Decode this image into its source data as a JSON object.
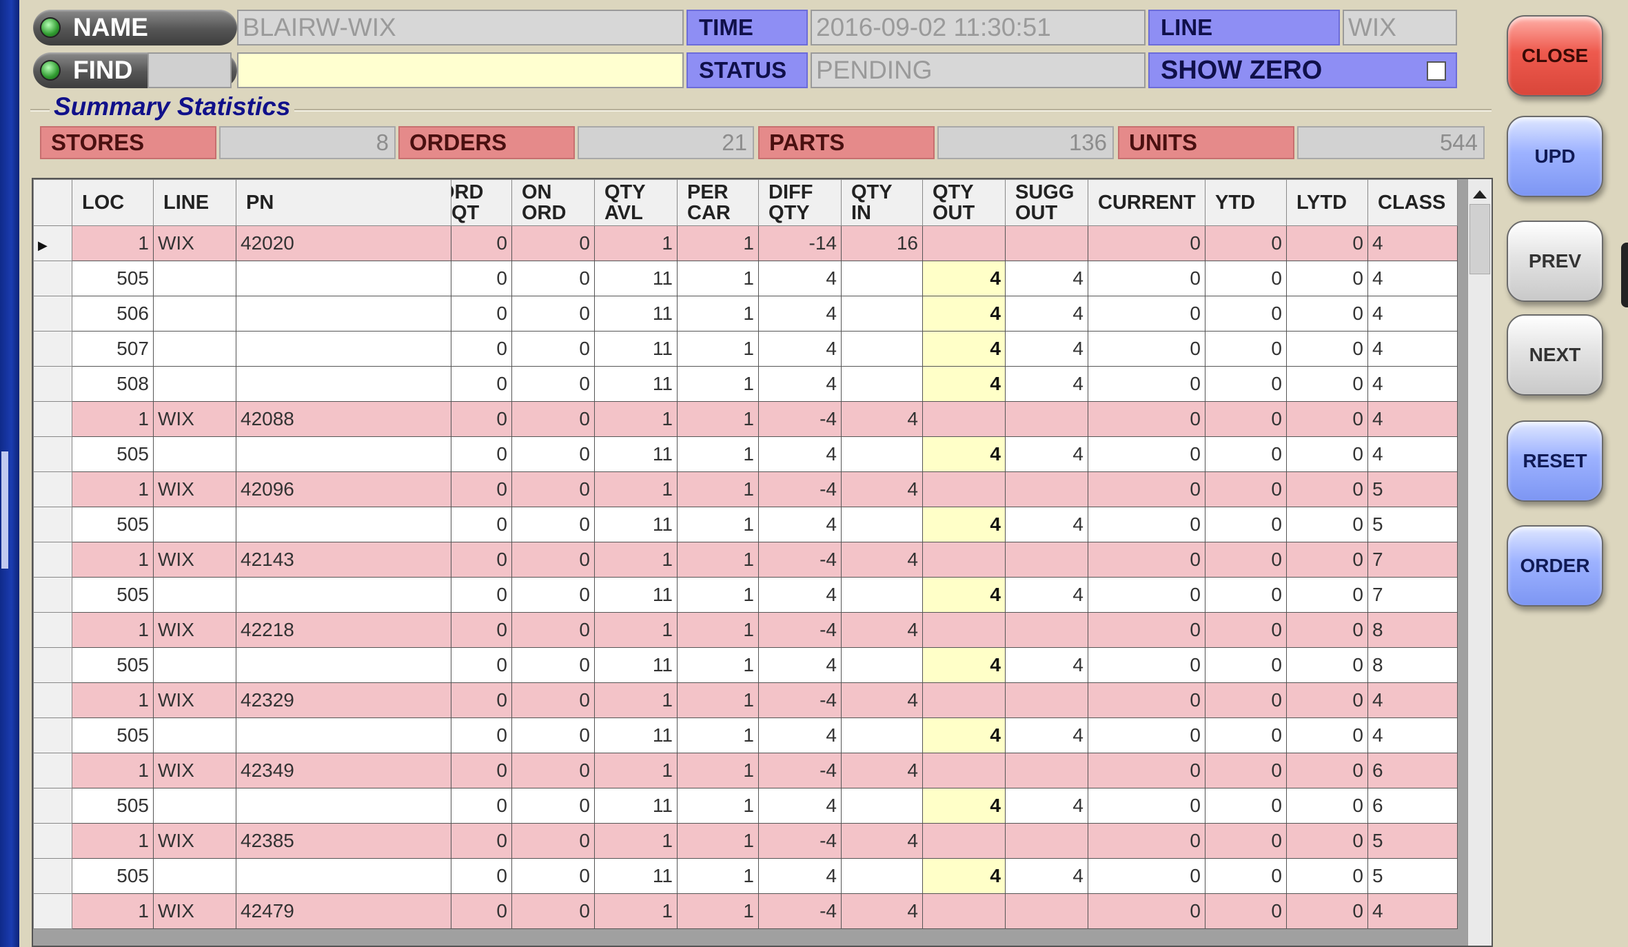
{
  "header": {
    "name_label": "NAME",
    "name_value": "BLAIRW-WIX",
    "find_label": "FIND",
    "find_value": "",
    "time_label": "TIME",
    "time_value": "2016-09-02 11:30:51",
    "line_label": "LINE",
    "line_value": "WIX",
    "status_label": "STATUS",
    "status_value": "PENDING",
    "show_zero_label": "SHOW ZERO",
    "show_zero_checked": false
  },
  "summary": {
    "title": "Summary Statistics",
    "stores_label": "STORES",
    "stores_value": "8",
    "orders_label": "ORDERS",
    "orders_value": "21",
    "parts_label": "PARTS",
    "parts_value": "136",
    "units_label": "UNITS",
    "units_value": "544"
  },
  "grid": {
    "columns": [
      "LOC",
      "LINE",
      "PN",
      "ORD\nQT",
      "ON\nORD",
      "QTY\nAVL",
      "PER\nCAR",
      "DIFF\nQTY",
      "QTY\nIN",
      "QTY\nOUT",
      "SUGG\nOUT",
      "CURRENT",
      "YTD",
      "LYTD",
      "CLASS"
    ],
    "rows": [
      {
        "style": "pink",
        "current": true,
        "cells": [
          "1",
          "WIX",
          "42020",
          "0",
          "0",
          "1",
          "1",
          "-14",
          "16",
          "",
          "",
          "0",
          "0",
          "0",
          "4"
        ]
      },
      {
        "style": "white",
        "cells": [
          "505",
          "",
          "",
          "0",
          "0",
          "11",
          "1",
          "4",
          "",
          "4",
          "4",
          "0",
          "0",
          "0",
          "4"
        ]
      },
      {
        "style": "white",
        "cells": [
          "506",
          "",
          "",
          "0",
          "0",
          "11",
          "1",
          "4",
          "",
          "4",
          "4",
          "0",
          "0",
          "0",
          "4"
        ]
      },
      {
        "style": "white",
        "cells": [
          "507",
          "",
          "",
          "0",
          "0",
          "11",
          "1",
          "4",
          "",
          "4",
          "4",
          "0",
          "0",
          "0",
          "4"
        ]
      },
      {
        "style": "white",
        "cells": [
          "508",
          "",
          "",
          "0",
          "0",
          "11",
          "1",
          "4",
          "",
          "4",
          "4",
          "0",
          "0",
          "0",
          "4"
        ]
      },
      {
        "style": "pink",
        "cells": [
          "1",
          "WIX",
          "42088",
          "0",
          "0",
          "1",
          "1",
          "-4",
          "4",
          "",
          "",
          "0",
          "0",
          "0",
          "4"
        ]
      },
      {
        "style": "white",
        "cells": [
          "505",
          "",
          "",
          "0",
          "0",
          "11",
          "1",
          "4",
          "",
          "4",
          "4",
          "0",
          "0",
          "0",
          "4"
        ]
      },
      {
        "style": "pink",
        "cells": [
          "1",
          "WIX",
          "42096",
          "0",
          "0",
          "1",
          "1",
          "-4",
          "4",
          "",
          "",
          "0",
          "0",
          "0",
          "5"
        ]
      },
      {
        "style": "white",
        "cells": [
          "505",
          "",
          "",
          "0",
          "0",
          "11",
          "1",
          "4",
          "",
          "4",
          "4",
          "0",
          "0",
          "0",
          "5"
        ]
      },
      {
        "style": "pink",
        "cells": [
          "1",
          "WIX",
          "42143",
          "0",
          "0",
          "1",
          "1",
          "-4",
          "4",
          "",
          "",
          "0",
          "0",
          "0",
          "7"
        ]
      },
      {
        "style": "white",
        "cells": [
          "505",
          "",
          "",
          "0",
          "0",
          "11",
          "1",
          "4",
          "",
          "4",
          "4",
          "0",
          "0",
          "0",
          "7"
        ]
      },
      {
        "style": "pink",
        "cells": [
          "1",
          "WIX",
          "42218",
          "0",
          "0",
          "1",
          "1",
          "-4",
          "4",
          "",
          "",
          "0",
          "0",
          "0",
          "8"
        ]
      },
      {
        "style": "white",
        "cells": [
          "505",
          "",
          "",
          "0",
          "0",
          "11",
          "1",
          "4",
          "",
          "4",
          "4",
          "0",
          "0",
          "0",
          "8"
        ]
      },
      {
        "style": "pink",
        "cells": [
          "1",
          "WIX",
          "42329",
          "0",
          "0",
          "1",
          "1",
          "-4",
          "4",
          "",
          "",
          "0",
          "0",
          "0",
          "4"
        ]
      },
      {
        "style": "white",
        "cells": [
          "505",
          "",
          "",
          "0",
          "0",
          "11",
          "1",
          "4",
          "",
          "4",
          "4",
          "0",
          "0",
          "0",
          "4"
        ]
      },
      {
        "style": "pink",
        "cells": [
          "1",
          "WIX",
          "42349",
          "0",
          "0",
          "1",
          "1",
          "-4",
          "4",
          "",
          "",
          "0",
          "0",
          "0",
          "6"
        ]
      },
      {
        "style": "white",
        "cells": [
          "505",
          "",
          "",
          "0",
          "0",
          "11",
          "1",
          "4",
          "",
          "4",
          "4",
          "0",
          "0",
          "0",
          "6"
        ]
      },
      {
        "style": "pink",
        "cells": [
          "1",
          "WIX",
          "42385",
          "0",
          "0",
          "1",
          "1",
          "-4",
          "4",
          "",
          "",
          "0",
          "0",
          "0",
          "5"
        ]
      },
      {
        "style": "white",
        "cells": [
          "505",
          "",
          "",
          "0",
          "0",
          "11",
          "1",
          "4",
          "",
          "4",
          "4",
          "0",
          "0",
          "0",
          "5"
        ]
      },
      {
        "style": "pink",
        "cells": [
          "1",
          "WIX",
          "42479",
          "0",
          "0",
          "1",
          "1",
          "-4",
          "4",
          "",
          "",
          "0",
          "0",
          "0",
          "4"
        ]
      }
    ]
  },
  "buttons": {
    "close": "CLOSE",
    "upd": "UPD",
    "prev": "PREV",
    "next": "NEXT",
    "reset": "RESET",
    "order": "ORDER"
  },
  "colors": {
    "pink_row": "#f3c3c8",
    "white_row": "#ffffff",
    "highlight_cell": "#ffffc8",
    "label_blue": "#8e8ef4",
    "stat_red": "#e58a8a",
    "close_red": "#ee5a4e",
    "button_blue": "#9db2ff"
  },
  "icons": {
    "name_led": "green-led-icon",
    "find_led": "green-led-icon",
    "row_pointer": "triangle-right-icon",
    "scroll_up": "triangle-up-icon"
  }
}
